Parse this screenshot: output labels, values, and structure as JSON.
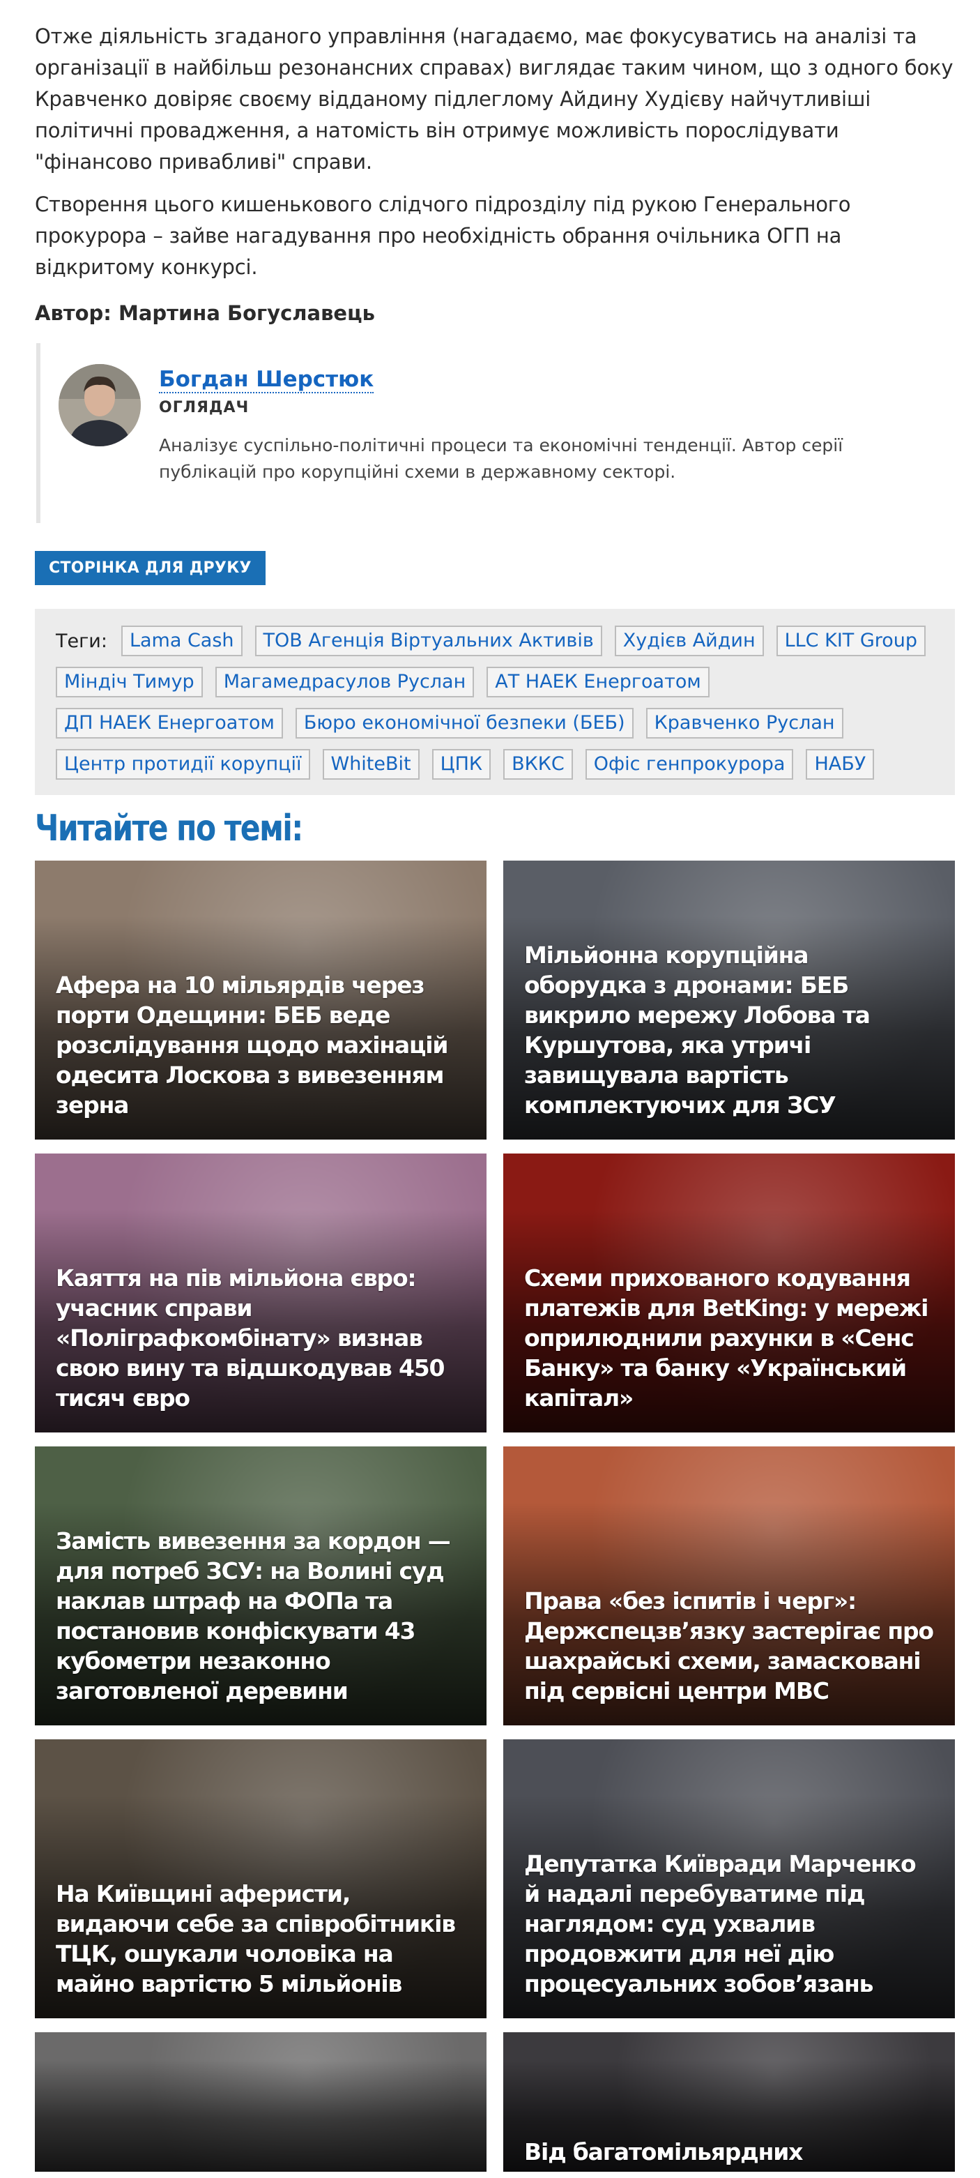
{
  "article": {
    "paragraphs": [
      "Отже діяльність згаданого управління (нагадаємо, має фокусуватись на аналізі та організації в найбільш резонансних справах) виглядає таким чином, що з одного боку Кравченко довіряє своєму відданому підлеглому Айдину Худієву найчутливіші політичні провадження, а натомість він отримує можливість порослідувати \"фінансово привабливі\" справи.",
      "Створення цього кишенькового слідчого підрозділу під рукою Генерального прокурора – зайве нагадування про необхідність обрання очільника ОГП на відкритому конкурсі."
    ],
    "author_line": "Автор: Мартина Богуславець"
  },
  "author_card": {
    "name": "Богдан Шерстюк",
    "role": "ОГЛЯДАЧ",
    "bio": "Аналізує суспільно-політичні процеси та економічні тенденції. Автор серії публікацій про корупційні схеми в державному секторі."
  },
  "print_button": "СТОРІНКА ДЛЯ ДРУКУ",
  "tags": {
    "label": "Теги:",
    "items": [
      "Lama Cash",
      "ТОВ Агенція Віртуальних Активів",
      "Худієв Айдин",
      "LLC KIT Group",
      "Міндіч Тимур",
      "Магамедрасулов Руслан",
      "АТ НАЕК Енергоатом",
      "ДП НАЕК Енергоатом",
      "Бюро економічної безпеки (БЕБ)",
      "Кравченко Руслан",
      "Центр протидії корупції",
      "WhiteBit",
      "ЦПК",
      "ВККС",
      "Офіс генпрокурора",
      "НАБУ"
    ]
  },
  "related": {
    "heading": "Читайте по темі:",
    "cards": [
      {
        "title": "Афера на 10 мільярдів через порти Одещини: БЕБ веде розслідування щодо махінацій одесита Лоскова з вивезенням зерна",
        "bg": "#8d7b6c"
      },
      {
        "title": "Мільйонна корупційна оборудка з дронами: БЕБ викрило мережу Лобова та Куршутова, яка утричі завищувала вартість комплектуючих для ЗСУ",
        "bg": "#5a5e66"
      },
      {
        "title": "Каяття на пів мільйона євро: учасник справи «Поліграфкомбінату» визнав свою вину та відшкодував 450 тисяч євро",
        "bg": "#9c6f8e"
      },
      {
        "title": "Схеми прихованого кодування платежів для BetKing: у мережі оприлюднили рахунки в «Сенс Банку» та банку «Український капітал»",
        "bg": "#8a1a14"
      },
      {
        "title": "Замість вивезення за кордон — для потреб ЗСУ: на Волині суд наклав штраф на ФОПа та постановив конфіскувати 43 кубометри незаконно заготовленої деревини",
        "bg": "#4e6046"
      },
      {
        "title": "Права «без іспитів і черг»: Держспецзв’язку застерігає про шахрайські схеми, замасковані під сервісні центри МВС",
        "bg": "#b4593a"
      },
      {
        "title": "На Київщині аферисти, видаючи себе за співробітників ТЦК, ошукали чоловіка на майно вартістю 5 мільйонів",
        "bg": "#5c5246"
      },
      {
        "title": "Депутатка Київради Марченко й надалі перебуватиме під наглядом: суд ухвалив продовжити для неї дію процесуальних зобов’язань",
        "bg": "#4d4f56"
      },
      {
        "title": "",
        "bg": "#6b6a6a"
      },
      {
        "title": "Від багатомільярдних",
        "bg": "#3c3a3e"
      }
    ]
  }
}
